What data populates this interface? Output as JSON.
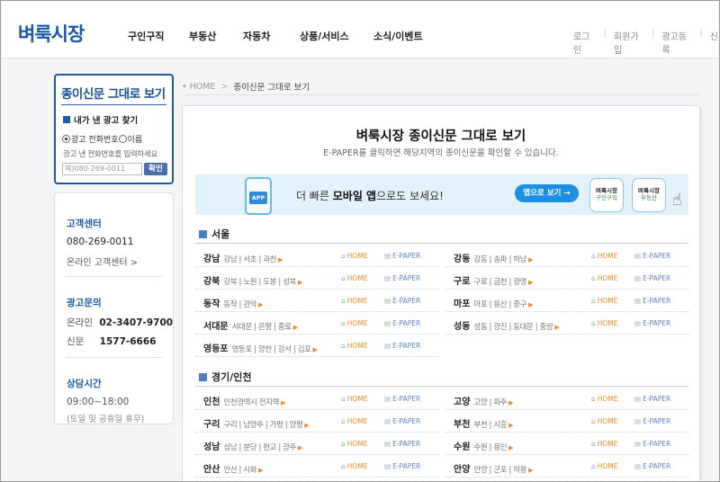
{
  "header": {
    "logo": "벼룩시장",
    "nav": [
      "구인구직",
      "부동산",
      "자동차",
      "상품/서비스",
      "소식/이벤트"
    ],
    "util": [
      "로그인",
      "회원가입",
      "광고등록",
      "신"
    ]
  },
  "sidebar": {
    "paper_title": "종이신문 그대로 보기",
    "find_title": "내가 낸 광고 찾기",
    "radio_phone": "광고 전화번호",
    "radio_name": "이름",
    "hint": "광고 낸 전화번호를 입력하세요",
    "phone_placeholder": "예)080-269-0011",
    "confirm": "확인",
    "cs_title": "고객센터",
    "cs_phone": "080-269-0011",
    "cs_online": "온라인 고객센터 >",
    "ad_title": "광고문의",
    "ad_online_label": "온라인",
    "ad_online_phone": "02-3407-9700",
    "ad_paper_label": "신문",
    "ad_paper_phone": "1577-6666",
    "hours_title": "상담시간",
    "hours": "09:00~18:00",
    "hours_note": "(토일 및 공휴일 휴무)"
  },
  "breadcrumb": {
    "home": "HOME",
    "current": "종이신문 그대로 보기"
  },
  "main": {
    "title": "벼룩시장 종이신문 그대로 보기",
    "subtitle": "E-PAPER를 클릭하면 해당지역의 종이신문을 확인할 수 있습니다.",
    "banner": {
      "phone_label": "APP",
      "text_pre": "더 빠른 ",
      "text_bold": "모바일 앱",
      "text_post": "으로도 보세요!",
      "button": "앱으로 보기 →",
      "app1_title": "벼룩시장",
      "app1_sub": "구인구직",
      "app2_title": "벼룩시장",
      "app2_sub": "부동산"
    },
    "home_label": "HOME",
    "epaper_label": "E-PAPER",
    "regions": [
      {
        "name": "서울",
        "rows": [
          [
            {
              "name": "강남",
              "areas": "강남 | 서초 | 과천"
            },
            {
              "name": "강동",
              "areas": "강동 | 송파 | 하남"
            }
          ],
          [
            {
              "name": "강북",
              "areas": "강북 | 노원 | 도봉 | 성북"
            },
            {
              "name": "구로",
              "areas": "구로 | 금천 | 광명"
            }
          ],
          [
            {
              "name": "동작",
              "areas": "동작 | 관악"
            },
            {
              "name": "마포",
              "areas": "마포 | 용산 | 중구"
            }
          ],
          [
            {
              "name": "서대문",
              "areas": "서대문 | 은평 | 종로"
            },
            {
              "name": "성동",
              "areas": "성동 | 광진 | 동대문 | 중랑"
            }
          ],
          [
            {
              "name": "영등포",
              "areas": "영등포 | 양천 | 강서 | 김포"
            }
          ]
        ]
      },
      {
        "name": "경기/인천",
        "rows": [
          [
            {
              "name": "인천",
              "areas": "인천광역시 전지역"
            },
            {
              "name": "고양",
              "areas": "고양 | 파주"
            }
          ],
          [
            {
              "name": "구리",
              "areas": "구리 | 남양주 | 가평 | 양평"
            },
            {
              "name": "부천",
              "areas": "부천 | 시흥"
            }
          ],
          [
            {
              "name": "성남",
              "areas": "성남 | 분당 | 판교 | 광주"
            },
            {
              "name": "수원",
              "areas": "수원 | 용인"
            }
          ],
          [
            {
              "name": "안산",
              "areas": "안산 | 시화"
            },
            {
              "name": "안양",
              "areas": "안양 | 군포 | 의왕"
            }
          ]
        ]
      }
    ]
  }
}
